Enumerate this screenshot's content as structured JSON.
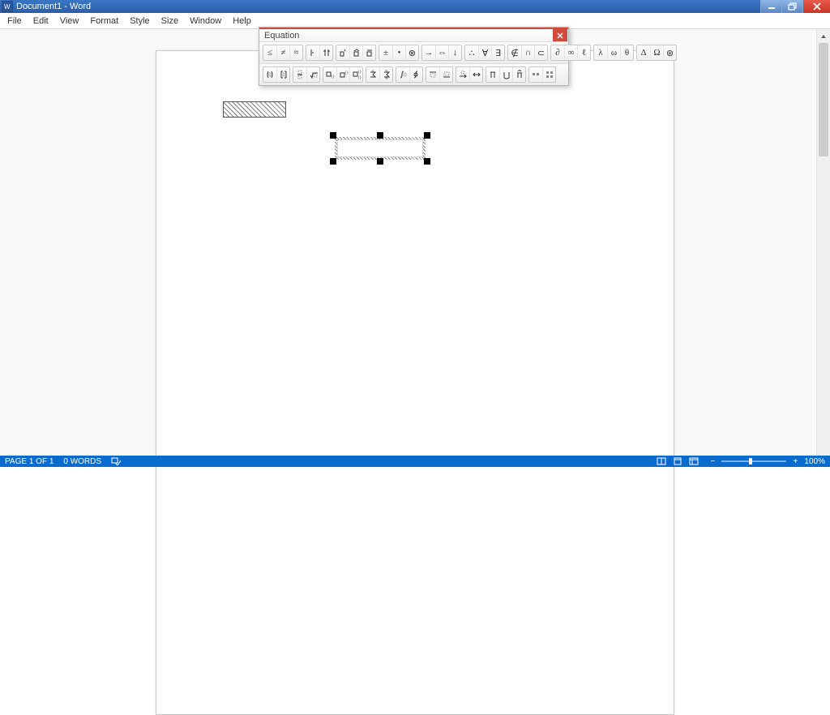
{
  "titlebar": {
    "title": "Document1 - Word"
  },
  "menus": [
    "File",
    "Edit",
    "View",
    "Format",
    "Style",
    "Size",
    "Window",
    "Help"
  ],
  "equation_window": {
    "title": "Equation"
  },
  "statusbar": {
    "page": "PAGE 1 OF 1",
    "words": "0 WORDS",
    "zoom_minus": "−",
    "zoom_plus": "+",
    "zoom_value": "100%"
  }
}
